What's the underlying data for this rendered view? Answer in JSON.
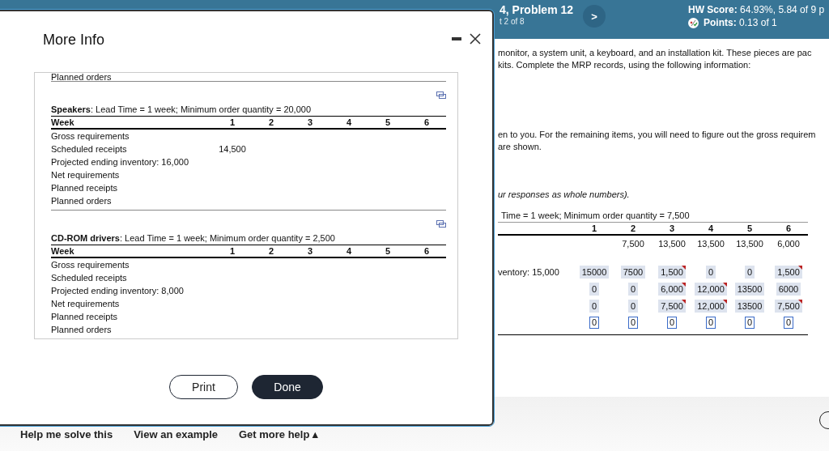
{
  "header": {
    "title": "4, Problem 12",
    "subtitle": "t 2 of 8",
    "next_button": ">",
    "hw_score_label": "HW Score:",
    "hw_score": "64.93%, 5.84 of 9 p",
    "points_label": "Points:",
    "points": "0.13 of 1"
  },
  "question": {
    "intro_lines": [
      "monitor, a system unit, a keyboard, and an installation kit. These pieces are pac",
      "kits. Complete the MRP records, using the following information:"
    ],
    "instruction_lines": [
      "en to you. For the remaining items, you will need to figure out the gross requirem",
      "are shown."
    ],
    "note": "ur responses as whole numbers).",
    "record": {
      "title": "Time = 1 week; Minimum order quantity = 7,500",
      "weeks": [
        "1",
        "2",
        "3",
        "4",
        "5",
        "6"
      ],
      "rows": [
        {
          "cells": [
            {
              "kind": "blank"
            },
            {
              "kind": "text",
              "value": "7,500"
            },
            {
              "kind": "text",
              "value": "13,500"
            },
            {
              "kind": "text",
              "value": "13,500"
            },
            {
              "kind": "text",
              "value": "13,500"
            },
            {
              "kind": "text",
              "value": "6,000"
            }
          ]
        },
        {
          "cells": [
            {
              "kind": "blank"
            },
            {
              "kind": "blank"
            },
            {
              "kind": "blank"
            },
            {
              "kind": "blank"
            },
            {
              "kind": "blank"
            },
            {
              "kind": "blank"
            }
          ]
        },
        {
          "label": "ventory: 15,000",
          "cells": [
            {
              "kind": "answer",
              "value": "15000",
              "flagged": false
            },
            {
              "kind": "answer",
              "value": "7500",
              "flagged": false
            },
            {
              "kind": "answer",
              "value": "1,500",
              "flagged": true
            },
            {
              "kind": "answer",
              "value": "0",
              "flagged": false
            },
            {
              "kind": "answer",
              "value": "0",
              "flagged": false
            },
            {
              "kind": "answer",
              "value": "1,500",
              "flagged": true
            }
          ]
        },
        {
          "cells": [
            {
              "kind": "answer",
              "value": "0",
              "flagged": false
            },
            {
              "kind": "answer",
              "value": "0",
              "flagged": false
            },
            {
              "kind": "answer",
              "value": "6,000",
              "flagged": true
            },
            {
              "kind": "answer",
              "value": "12,000",
              "flagged": true
            },
            {
              "kind": "answer",
              "value": "13500",
              "flagged": false
            },
            {
              "kind": "answer",
              "value": "6000",
              "flagged": false
            }
          ]
        },
        {
          "cells": [
            {
              "kind": "answer",
              "value": "0",
              "flagged": false
            },
            {
              "kind": "answer",
              "value": "0",
              "flagged": false
            },
            {
              "kind": "answer",
              "value": "7,500",
              "flagged": true
            },
            {
              "kind": "answer",
              "value": "12,000",
              "flagged": true
            },
            {
              "kind": "answer",
              "value": "13500",
              "flagged": false
            },
            {
              "kind": "answer",
              "value": "7,500",
              "flagged": true
            }
          ]
        },
        {
          "cells": [
            {
              "kind": "input",
              "value": "0"
            },
            {
              "kind": "input",
              "value": "0"
            },
            {
              "kind": "input",
              "value": "0"
            },
            {
              "kind": "input",
              "value": "0"
            },
            {
              "kind": "input",
              "value": "0"
            },
            {
              "kind": "input",
              "value": "0"
            }
          ]
        }
      ]
    }
  },
  "modal": {
    "title": "More Info",
    "cut_row": "Planned orders",
    "records": [
      {
        "title": "**Speakers**: Lead Time = 1 week; Minimum order quantity = 20,000",
        "week_label": "Week",
        "weeks": [
          "1",
          "2",
          "3",
          "4",
          "5",
          "6"
        ],
        "rows": [
          {
            "label": "Gross requirements",
            "cells": []
          },
          {
            "label": "Scheduled receipts",
            "cells": [
              "14,500"
            ]
          },
          {
            "label": "Projected ending inventory: 16,000",
            "cells": []
          },
          {
            "label": "Net requirements",
            "cells": []
          },
          {
            "label": "Planned receipts",
            "cells": []
          },
          {
            "label": "Planned orders",
            "cells": []
          }
        ]
      },
      {
        "title": "**CD-ROM drivers**: Lead Time = 1 week; Minimum order quantity = 2,500",
        "week_label": "Week",
        "weeks": [
          "1",
          "2",
          "3",
          "4",
          "5",
          "6"
        ],
        "rows": [
          {
            "label": "Gross requirements",
            "cells": []
          },
          {
            "label": "Scheduled receipts",
            "cells": []
          },
          {
            "label": "Projected ending inventory: 8,000",
            "cells": []
          },
          {
            "label": "Net requirements",
            "cells": []
          },
          {
            "label": "Planned receipts",
            "cells": []
          },
          {
            "label": "Planned orders",
            "cells": []
          }
        ]
      }
    ],
    "buttons": [
      {
        "label": "Print",
        "kind": "secondary"
      },
      {
        "label": "Done",
        "kind": "primary"
      }
    ]
  },
  "help_bar": {
    "links": [
      "Help me solve this",
      "View an example"
    ],
    "more_help": "Get more help ▴"
  }
}
